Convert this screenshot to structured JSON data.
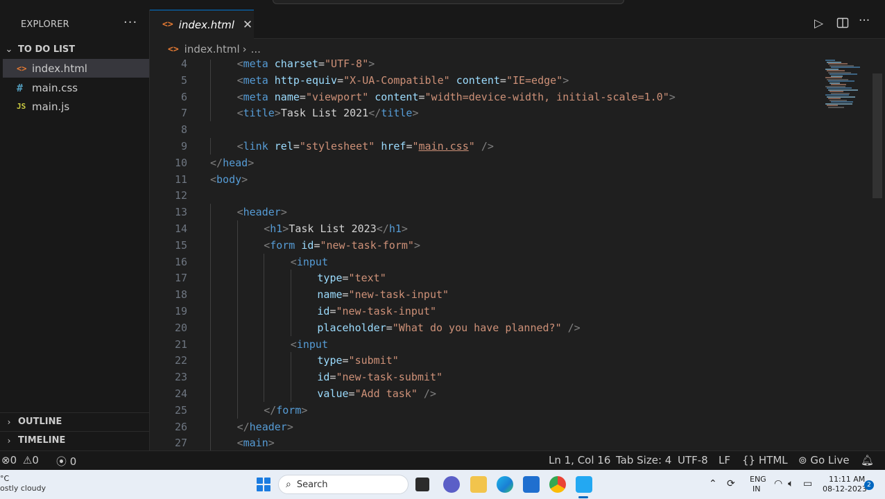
{
  "sidebar": {
    "title": "EXPLORER",
    "more_label": "···",
    "folder": "TO DO LIST",
    "files": [
      {
        "name": "index.html",
        "icon": "html-file-icon",
        "glyph": "<>"
      },
      {
        "name": "main.css",
        "icon": "css-file-icon",
        "glyph": "#"
      },
      {
        "name": "main.js",
        "icon": "js-file-icon",
        "glyph": "JS"
      }
    ],
    "outline": "OUTLINE",
    "timeline": "TIMELINE"
  },
  "tabs": [
    {
      "label": "index.html",
      "icon": "html-file-icon",
      "glyph": "<>",
      "close": "✕"
    }
  ],
  "breadcrumb": {
    "file": "index.html",
    "more": "..."
  },
  "editor": {
    "lines": [
      {
        "n": "4",
        "tokens": [
          [
            "p",
            "<"
          ],
          [
            "g",
            "meta"
          ],
          [
            "t",
            " "
          ],
          [
            "a",
            "charset"
          ],
          [
            "t",
            "="
          ],
          [
            "s",
            "\"UTF-8\""
          ],
          [
            "p",
            ">"
          ]
        ]
      },
      {
        "n": "5",
        "tokens": [
          [
            "p",
            "<"
          ],
          [
            "g",
            "meta"
          ],
          [
            "t",
            " "
          ],
          [
            "a",
            "http-equiv"
          ],
          [
            "t",
            "="
          ],
          [
            "s",
            "\"X-UA-Compatible\""
          ],
          [
            "t",
            " "
          ],
          [
            "a",
            "content"
          ],
          [
            "t",
            "="
          ],
          [
            "s",
            "\"IE=edge\""
          ],
          [
            "p",
            ">"
          ]
        ]
      },
      {
        "n": "6",
        "tokens": [
          [
            "p",
            "<"
          ],
          [
            "g",
            "meta"
          ],
          [
            "t",
            " "
          ],
          [
            "a",
            "name"
          ],
          [
            "t",
            "="
          ],
          [
            "s",
            "\"viewport\""
          ],
          [
            "t",
            " "
          ],
          [
            "a",
            "content"
          ],
          [
            "t",
            "="
          ],
          [
            "s",
            "\"width=device-width, initial-scale=1.0\""
          ],
          [
            "p",
            ">"
          ]
        ]
      },
      {
        "n": "7",
        "tokens": [
          [
            "p",
            "<"
          ],
          [
            "g",
            "title"
          ],
          [
            "p",
            ">"
          ],
          [
            "t",
            "Task List 2021"
          ],
          [
            "p",
            "</"
          ],
          [
            "g",
            "title"
          ],
          [
            "p",
            ">"
          ]
        ]
      },
      {
        "n": "8",
        "tokens": []
      },
      {
        "n": "9",
        "tokens": [
          [
            "p",
            "<"
          ],
          [
            "g",
            "link"
          ],
          [
            "t",
            " "
          ],
          [
            "a",
            "rel"
          ],
          [
            "t",
            "="
          ],
          [
            "s",
            "\"stylesheet\""
          ],
          [
            "t",
            " "
          ],
          [
            "a",
            "href"
          ],
          [
            "t",
            "="
          ],
          [
            "s",
            "\""
          ],
          [
            "u",
            "main.css"
          ],
          [
            "s",
            "\""
          ],
          [
            "t",
            " "
          ],
          [
            "p",
            "/>"
          ]
        ]
      },
      {
        "n": "10",
        "tokens": [
          [
            "p",
            "</"
          ],
          [
            "g",
            "head"
          ],
          [
            "p",
            ">"
          ]
        ]
      },
      {
        "n": "11",
        "tokens": [
          [
            "p",
            "<"
          ],
          [
            "g",
            "body"
          ],
          [
            "p",
            ">"
          ]
        ]
      },
      {
        "n": "12",
        "tokens": []
      },
      {
        "n": "13",
        "tokens": [
          [
            "p",
            "<"
          ],
          [
            "g",
            "header"
          ],
          [
            "p",
            ">"
          ]
        ]
      },
      {
        "n": "14",
        "tokens": [
          [
            "p",
            "<"
          ],
          [
            "g",
            "h1"
          ],
          [
            "p",
            ">"
          ],
          [
            "t",
            "Task List 2023"
          ],
          [
            "p",
            "</"
          ],
          [
            "g",
            "h1"
          ],
          [
            "p",
            ">"
          ]
        ]
      },
      {
        "n": "15",
        "tokens": [
          [
            "p",
            "<"
          ],
          [
            "g",
            "form"
          ],
          [
            "t",
            " "
          ],
          [
            "a",
            "id"
          ],
          [
            "t",
            "="
          ],
          [
            "s",
            "\"new-task-form\""
          ],
          [
            "p",
            ">"
          ]
        ]
      },
      {
        "n": "16",
        "tokens": [
          [
            "p",
            "<"
          ],
          [
            "g",
            "input"
          ]
        ]
      },
      {
        "n": "17",
        "tokens": [
          [
            "a",
            "type"
          ],
          [
            "t",
            "="
          ],
          [
            "s",
            "\"text\""
          ]
        ]
      },
      {
        "n": "18",
        "tokens": [
          [
            "a",
            "name"
          ],
          [
            "t",
            "="
          ],
          [
            "s",
            "\"new-task-input\""
          ]
        ]
      },
      {
        "n": "19",
        "tokens": [
          [
            "a",
            "id"
          ],
          [
            "t",
            "="
          ],
          [
            "s",
            "\"new-task-input\""
          ]
        ]
      },
      {
        "n": "20",
        "tokens": [
          [
            "a",
            "placeholder"
          ],
          [
            "t",
            "="
          ],
          [
            "s",
            "\"What do you have planned?\""
          ],
          [
            "t",
            " "
          ],
          [
            "p",
            "/>"
          ]
        ]
      },
      {
        "n": "21",
        "tokens": [
          [
            "p",
            "<"
          ],
          [
            "g",
            "input"
          ]
        ]
      },
      {
        "n": "22",
        "tokens": [
          [
            "a",
            "type"
          ],
          [
            "t",
            "="
          ],
          [
            "s",
            "\"submit\""
          ]
        ]
      },
      {
        "n": "23",
        "tokens": [
          [
            "a",
            "id"
          ],
          [
            "t",
            "="
          ],
          [
            "s",
            "\"new-task-submit\""
          ]
        ]
      },
      {
        "n": "24",
        "tokens": [
          [
            "a",
            "value"
          ],
          [
            "t",
            "="
          ],
          [
            "s",
            "\"Add task\""
          ],
          [
            "t",
            " "
          ],
          [
            "p",
            "/>"
          ]
        ]
      },
      {
        "n": "25",
        "tokens": [
          [
            "p",
            "</"
          ],
          [
            "g",
            "form"
          ],
          [
            "p",
            ">"
          ]
        ]
      },
      {
        "n": "26",
        "tokens": [
          [
            "p",
            "</"
          ],
          [
            "g",
            "header"
          ],
          [
            "p",
            ">"
          ]
        ]
      },
      {
        "n": "27",
        "tokens": [
          [
            "p",
            "<"
          ],
          [
            "g",
            "main"
          ],
          [
            "p",
            ">"
          ]
        ]
      }
    ],
    "indents": [
      1,
      1,
      1,
      1,
      0,
      1,
      0,
      0,
      0,
      1,
      2,
      2,
      3,
      4,
      4,
      4,
      4,
      3,
      4,
      4,
      4,
      2,
      1,
      1
    ]
  },
  "statusbar": {
    "errors": "0",
    "warnings": "0",
    "ports": "0",
    "position": "Ln 1, Col 16",
    "tab_size": "Tab Size: 4",
    "encoding": "UTF-8",
    "eol": "LF",
    "language": "HTML",
    "go_live": "Go Live"
  },
  "taskbar": {
    "weather_temp": "°C",
    "weather_desc": "ostly cloudy",
    "search_label": "Search",
    "lang1": "ENG",
    "lang2": "IN",
    "time": "11:11 AM",
    "date": "08-12-2023",
    "badge": "2"
  },
  "colors": {
    "accent": "#0078d4",
    "tag": "#569cd6",
    "attribute": "#9cdcfe",
    "string": "#ce9178"
  }
}
